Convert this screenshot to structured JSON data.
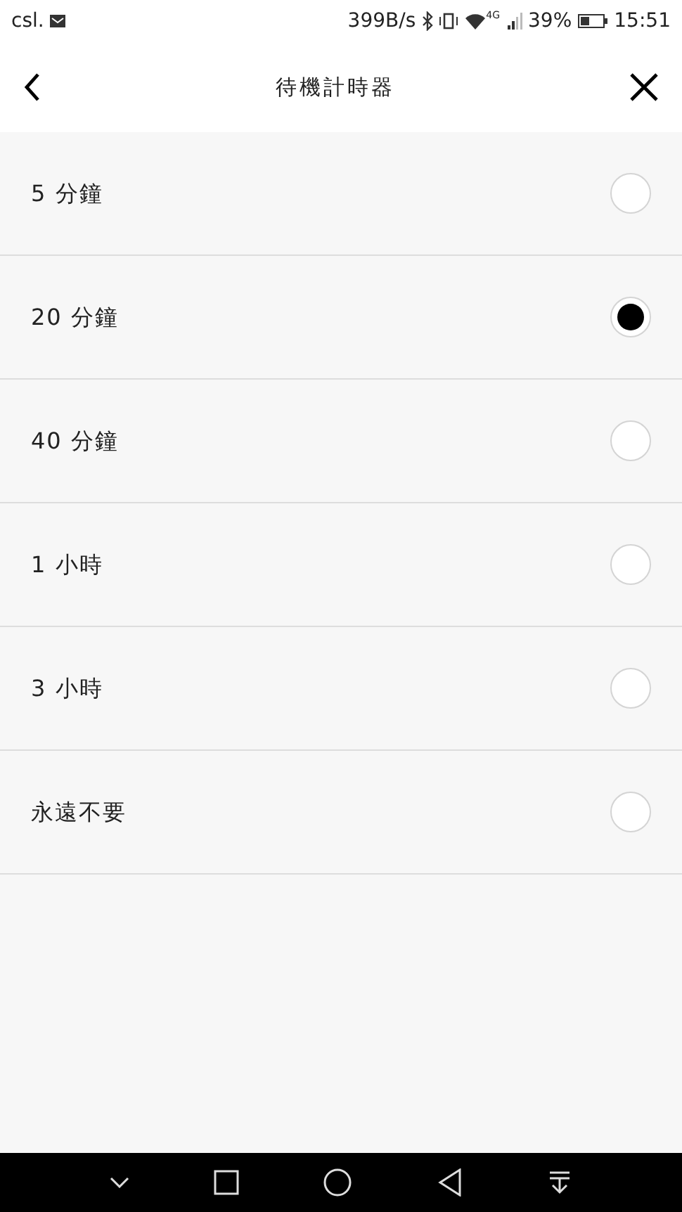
{
  "status_bar": {
    "carrier": "csl.",
    "speed": "399B/s",
    "network": "4G",
    "battery": "39%",
    "time": "15:51"
  },
  "header": {
    "title": "待機計時器"
  },
  "options": [
    {
      "label": "5 分鐘",
      "selected": false
    },
    {
      "label": "20 分鐘",
      "selected": true
    },
    {
      "label": "40 分鐘",
      "selected": false
    },
    {
      "label": "1 小時",
      "selected": false
    },
    {
      "label": "3 小時",
      "selected": false
    },
    {
      "label": "永遠不要",
      "selected": false
    }
  ]
}
